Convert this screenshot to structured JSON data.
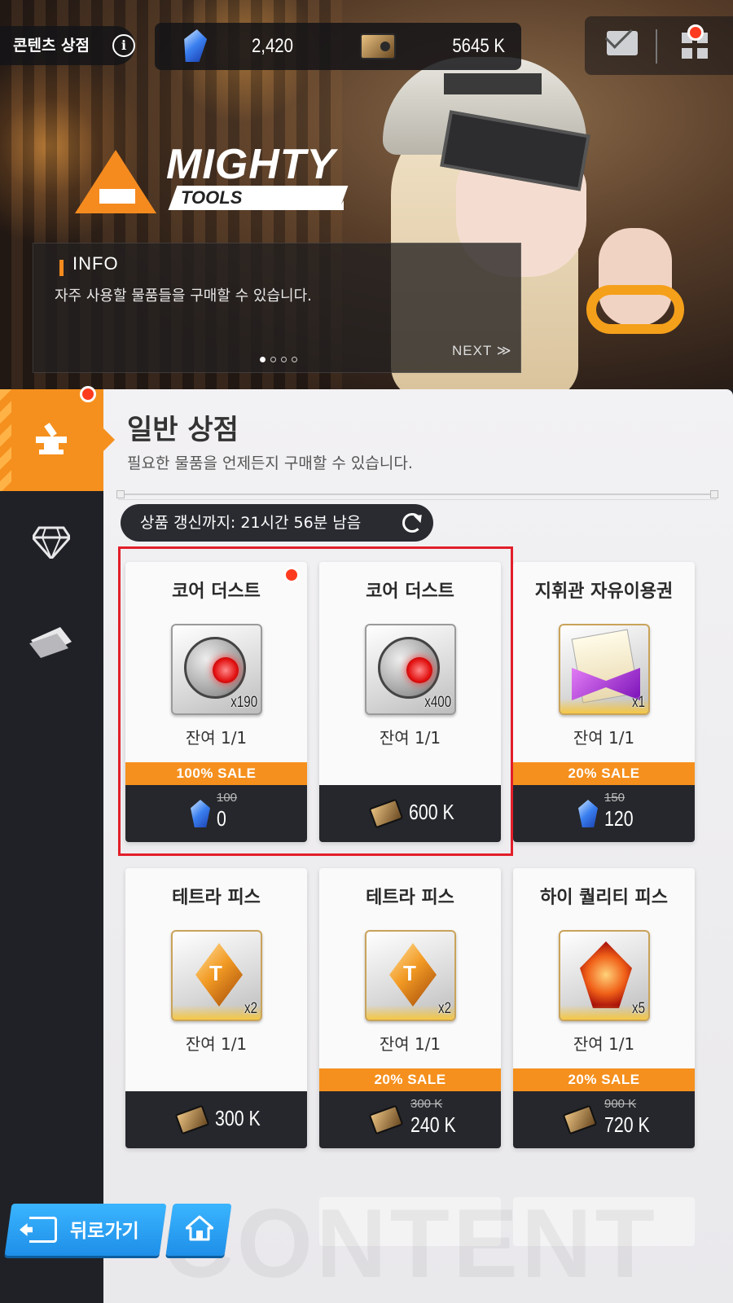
{
  "header": {
    "title": "콘텐츠 상점",
    "info_icon": "i",
    "gems": "2,420",
    "credits": "5645 K"
  },
  "banner": {
    "logo_title": "MIGHTY",
    "logo_sub": "TOOLS",
    "info_label": "INFO",
    "info_desc": "자주 사용할 물품들을 구매할 수 있습니다.",
    "next_label": "NEXT ≫",
    "page_count": 4,
    "active_page": 1
  },
  "sidebar": {
    "items": [
      {
        "icon": "anvil-icon",
        "active": true
      },
      {
        "icon": "diamond-icon",
        "active": false
      },
      {
        "icon": "ticket-icon",
        "active": false
      }
    ]
  },
  "shop": {
    "title": "일반 상점",
    "desc": "필요한 물품을 언제든지 구매할 수 있습니다.",
    "refresh_text": "상품 갱신까지: 21시간 56분 남음"
  },
  "products": [
    {
      "name": "코어 더스트",
      "art": "core",
      "qty": "x190",
      "remain": "잔여 1/1",
      "sale": "100% SALE",
      "currency": "gem",
      "old_price": "100",
      "price": "0",
      "new_badge": true
    },
    {
      "name": "코어 더스트",
      "art": "core",
      "qty": "x400",
      "remain": "잔여 1/1",
      "sale": "",
      "currency": "credit",
      "old_price": "",
      "price": "600 K",
      "new_badge": false
    },
    {
      "name": "지휘관 자유이용권",
      "art": "ticket",
      "qty": "x1",
      "remain": "잔여 1/1",
      "sale": "20% SALE",
      "currency": "gem",
      "old_price": "150",
      "price": "120",
      "new_badge": false
    },
    {
      "name": "테트라 피스",
      "art": "tetra",
      "qty": "x2",
      "remain": "잔여 1/1",
      "sale": "",
      "currency": "credit",
      "old_price": "",
      "price": "300 K",
      "new_badge": false
    },
    {
      "name": "테트라 피스",
      "art": "tetra",
      "qty": "x2",
      "remain": "잔여 1/1",
      "sale": "20% SALE",
      "currency": "credit",
      "old_price": "300 K",
      "price": "240 K",
      "new_badge": false
    },
    {
      "name": "하이 퀄리티 피스",
      "art": "hq",
      "qty": "x5",
      "remain": "잔여 1/1",
      "sale": "20% SALE",
      "currency": "credit",
      "old_price": "900 K",
      "price": "720 K",
      "new_badge": false
    }
  ],
  "footer": {
    "back_label": "뒤로가기",
    "watermark": "CONTENT"
  },
  "colors": {
    "accent": "#f5901e",
    "highlight": "#e21e2a",
    "button_blue": "#1e8fe8",
    "badge_red": "#ff3b1f"
  }
}
